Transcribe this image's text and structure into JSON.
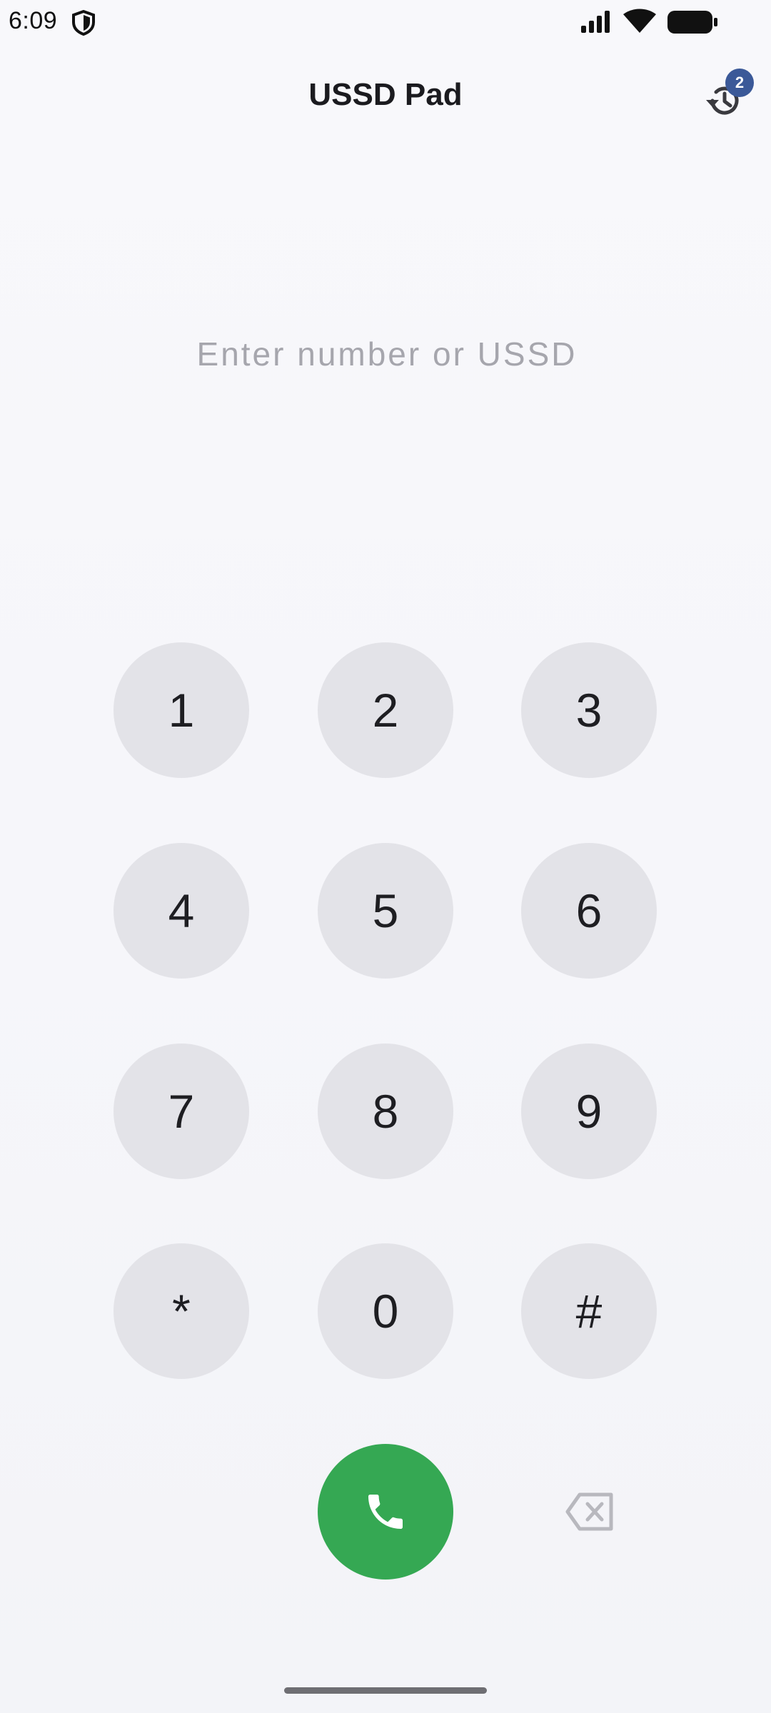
{
  "status_bar": {
    "time": "6:09",
    "icons": [
      "shield-icon",
      "signal-icon",
      "wifi-icon",
      "battery-icon"
    ]
  },
  "header": {
    "title": "USSD Pad",
    "history_badge_count": "2",
    "history_icon": "history-icon"
  },
  "input": {
    "value": "",
    "placeholder": "Enter number or USSD"
  },
  "keypad": {
    "keys": [
      "1",
      "2",
      "3",
      "4",
      "5",
      "6",
      "7",
      "8",
      "9",
      "*",
      "0",
      "#"
    ]
  },
  "actions": {
    "call_icon": "phone-icon",
    "backspace_icon": "backspace-icon"
  },
  "colors": {
    "background": "#f6f6fa",
    "key_background": "#e3e3e8",
    "call_button": "#35a853",
    "badge": "#3b5998",
    "placeholder": "#a6a6ad"
  }
}
